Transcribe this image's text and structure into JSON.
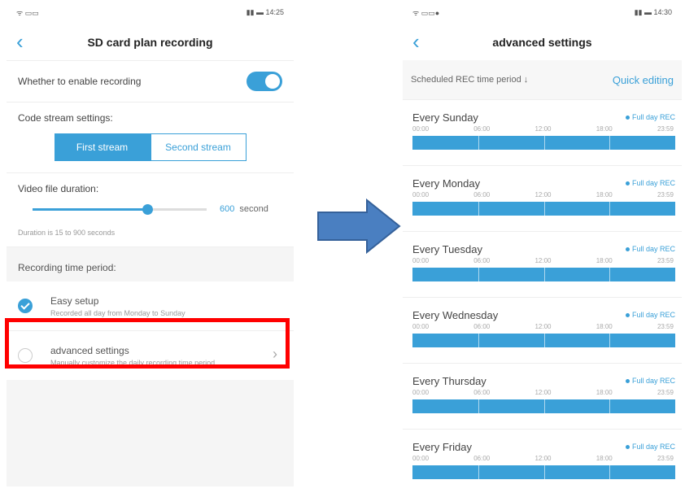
{
  "left": {
    "status": {
      "left": "⁠ᯤ ⁠▭▭",
      "right": "⁠▮▮ ▬ 14:25"
    },
    "title": "SD card plan recording",
    "enable_label": "Whether to enable recording",
    "enable_on": true,
    "stream_label": "Code stream settings:",
    "streams": [
      "First stream",
      "Second stream"
    ],
    "selected_stream": "First stream",
    "duration_label": "Video file duration:",
    "duration_value": "600",
    "duration_unit": "second",
    "duration_fraction": 0.66,
    "duration_hint": "Duration is 15 to 900 seconds",
    "period_label": "Recording time period:",
    "options": [
      {
        "title": "Easy setup",
        "desc": "Recorded all day from Monday to Sunday",
        "selected": true
      },
      {
        "title": "advanced settings",
        "desc": "Manually customize the daily recording time period",
        "selected": false
      }
    ]
  },
  "right": {
    "status": {
      "left": "⁠ᯤ ⁠▭▭●",
      "right": "⁠▮▮ ▬ 14:30"
    },
    "title": "advanced settings",
    "schedule_label": "Scheduled REC time period ↓",
    "quick_edit": "Quick editing",
    "ticks": [
      "00:00",
      "06:00",
      "12:00",
      "18:00",
      "23:59"
    ],
    "days": [
      {
        "name": "Every Sunday",
        "badge": "Full day REC"
      },
      {
        "name": "Every Monday",
        "badge": "Full day REC"
      },
      {
        "name": "Every Tuesday",
        "badge": "Full day REC"
      },
      {
        "name": "Every Wednesday",
        "badge": "Full day REC"
      },
      {
        "name": "Every Thursday",
        "badge": "Full day REC"
      },
      {
        "name": "Every Friday",
        "badge": "Full day REC"
      }
    ]
  },
  "colors": {
    "accent": "#3aa0d8",
    "highlight": "#ff0000",
    "arrow": "#4a7fc1"
  }
}
